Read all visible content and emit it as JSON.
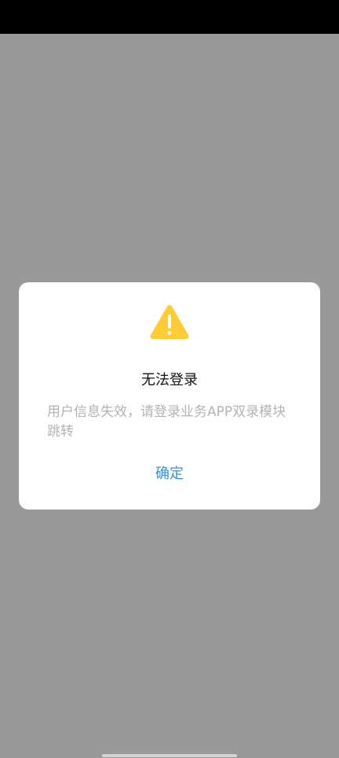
{
  "dialog": {
    "icon": "warning-triangle-icon",
    "icon_color": "#ffcc33",
    "title": "无法登录",
    "message": "用户信息失效，请登录业务APP双录模块跳转",
    "confirm_label": "确定",
    "confirm_color": "#3a8fcf"
  },
  "overlay_color": "#999999",
  "status_bar_color": "#000000"
}
